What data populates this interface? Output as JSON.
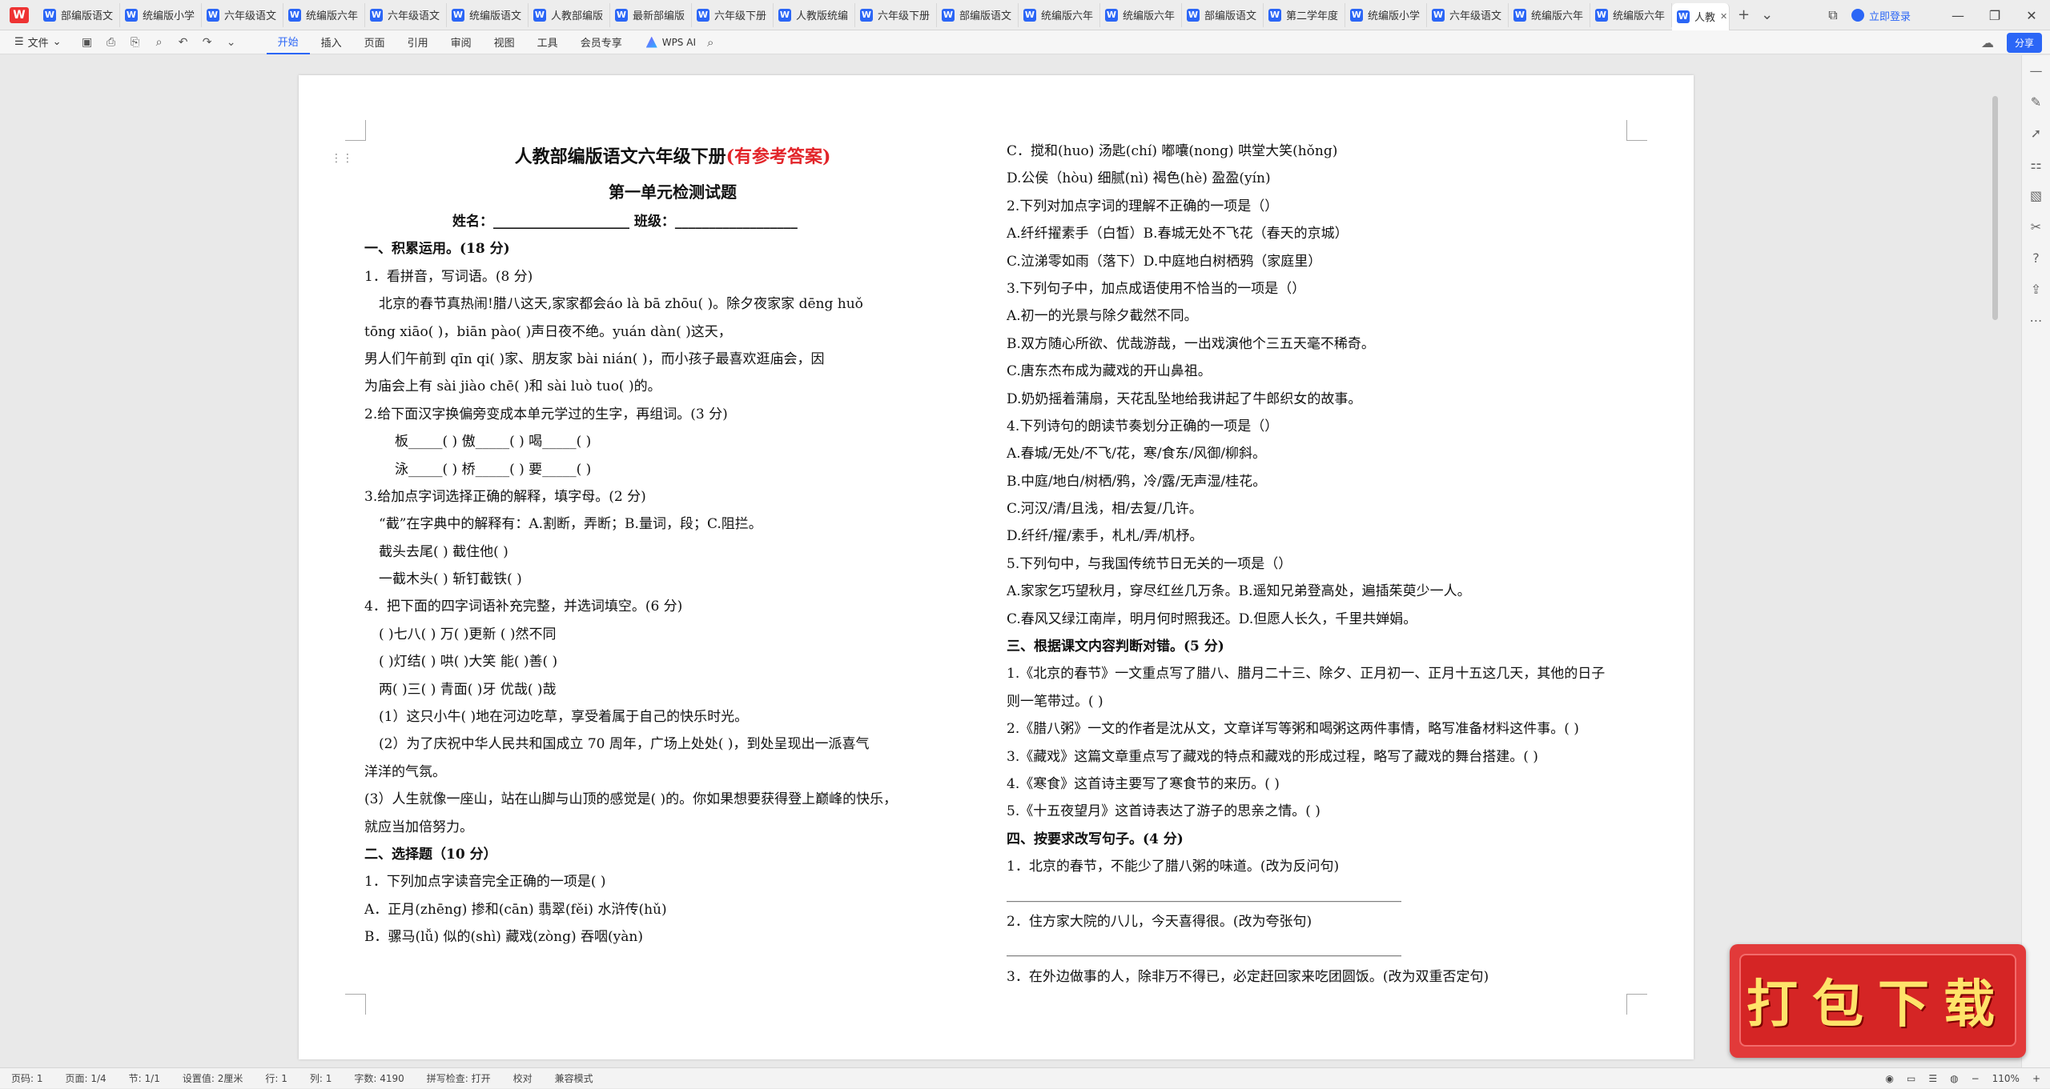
{
  "app": {
    "logo": "W"
  },
  "tabs": [
    {
      "label": "部编版语文"
    },
    {
      "label": "统编版小学"
    },
    {
      "label": "六年级语文"
    },
    {
      "label": "统编版六年"
    },
    {
      "label": "六年级语文"
    },
    {
      "label": "统编版语文"
    },
    {
      "label": "人教部编版"
    },
    {
      "label": "最新部编版"
    },
    {
      "label": "六年级下册"
    },
    {
      "label": "人教版统编"
    },
    {
      "label": "六年级下册"
    },
    {
      "label": "部编版语文"
    },
    {
      "label": "统编版六年"
    },
    {
      "label": "统编版六年"
    },
    {
      "label": "部编版语文"
    },
    {
      "label": "第二学年度"
    },
    {
      "label": "统编版小学"
    },
    {
      "label": "六年级语文"
    },
    {
      "label": "统编版六年"
    },
    {
      "label": "统编版六年"
    }
  ],
  "active_tab": {
    "label": "人教"
  },
  "tab_controls": {
    "add": "+",
    "dropdown": "⌄"
  },
  "window": {
    "login": "立即登录",
    "minimize": "—",
    "restore": "❐",
    "close": "✕",
    "tile": "⧉"
  },
  "toolbar": {
    "file": "文件",
    "menus": [
      "开始",
      "插入",
      "页面",
      "引用",
      "审阅",
      "视图",
      "工具",
      "会员专享"
    ],
    "active_menu": "开始",
    "ai": "WPS AI",
    "share": "分享"
  },
  "document": {
    "title_main": "人教部编版语文六年级下册",
    "title_red": "(有参考答案)",
    "subtitle": "第一单元检测试题",
    "name_line": "姓名：____________________  班级：__________________",
    "left_lines": [
      {
        "t": "一、积累运用。(18 分)",
        "s": "sec"
      },
      {
        "t": "1．看拼音，写词语。(8 分)",
        "s": ""
      },
      {
        "t": "北京的春节真热闹!腊八这天,家家都会áo  là  bā  zhōu(          )。除夕夜家家 dēng  huǒ",
        "s": "in1"
      },
      {
        "t": "tōng  xiāo(          )，biān  pào(          )声日夜不绝。yuán  dàn(          )这天，",
        "s": ""
      },
      {
        "t": "男人们午前到 qīn  qi(          )家、朋友家 bài  nián(          )，而小孩子最喜欢逛庙会，因",
        "s": ""
      },
      {
        "t": "为庙会上有 sài  jiào  chē(          )和 sài  luò  tuo(          )的。",
        "s": ""
      },
      {
        "t": "2.给下面汉字换偏旁变成本单元学过的生字，再组词。(3 分)",
        "s": ""
      },
      {
        "t": "板_____(        )      傲_____(        )      喝_____(        )",
        "s": "in2"
      },
      {
        "t": "泳_____(        )      桥_____(        )      要_____(        )",
        "s": "in2"
      },
      {
        "t": "3.给加点字词选择正确的解释，填字母。(2 分)",
        "s": ""
      },
      {
        "t": "“截”在字典中的解释有：A.割断，弄断；B.量词，段；C.阻拦。",
        "s": "in1"
      },
      {
        "t": "截头去尾(      )        截住他(      )",
        "s": "in1"
      },
      {
        "t": "一截木头(      )        斩钉截铁(      )",
        "s": "in1"
      },
      {
        "t": "4．把下面的四字词语补充完整，并选词填空。(6 分)",
        "s": ""
      },
      {
        "t": "(      )七八(      )     万(      )更新         (      )然不同",
        "s": "in1"
      },
      {
        "t": "(      )灯结(      )     哄(      )大笑         能(      )善(      )",
        "s": "in1"
      },
      {
        "t": "两(      )三(      )     青面(      )牙         优哉(      )哉",
        "s": "in1"
      },
      {
        "t": "(1）这只小牛(          )地在河边吃草，享受着属于自己的快乐时光。",
        "s": "in1"
      },
      {
        "t": "(2）为了庆祝中华人民共和国成立 70 周年，广场上处处(                )，到处呈现出一派喜气",
        "s": "in1"
      },
      {
        "t": "洋洋的气氛。",
        "s": ""
      },
      {
        "t": "(3）人生就像一座山，站在山脚与山顶的感觉是(          )的。你如果想要获得登上巅峰的快乐，",
        "s": ""
      },
      {
        "t": "就应当加倍努力。",
        "s": ""
      },
      {
        "t": "二、选择题（10 分）",
        "s": "sec"
      },
      {
        "t": "1．下列加点字读音完全正确的一项是(      )",
        "s": ""
      },
      {
        "t": "A．正月(zhēng)        掺和(cān)        翡翠(fěi)        水浒传(hǔ)",
        "s": ""
      },
      {
        "t": "B．骡马(lǚ)           似的(shì)         藏戏(zòng)       吞咽(yàn)",
        "s": ""
      }
    ],
    "right_lines": [
      {
        "t": "C．搅和(huo)          汤匙(chí)         嘟囔(nong)       哄堂大笑(hǒng)",
        "s": ""
      },
      {
        "t": "D.公侯（hòu)          细腻(nì)  褐色(hè)       盈盈(yín)",
        "s": ""
      },
      {
        "t": "2.下列对加点字词的理解不正确的一项是（）",
        "s": ""
      },
      {
        "t": "A.纤纤擢素手（白皙）B.春城无处不飞花（春天的京城）",
        "s": ""
      },
      {
        "t": "C.泣涕零如雨（落下）D.中庭地白树栖鸦（家庭里）",
        "s": ""
      },
      {
        "t": "3.下列句子中，加点成语使用不恰当的一项是（）",
        "s": ""
      },
      {
        "t": "A.初一的光景与除夕截然不同。",
        "s": ""
      },
      {
        "t": "B.双方随心所欲、优哉游哉，一出戏演他个三五天毫不稀奇。",
        "s": ""
      },
      {
        "t": "C.唐东杰布成为藏戏的开山鼻祖。",
        "s": ""
      },
      {
        "t": "D.奶奶摇着蒲扇，天花乱坠地给我讲起了牛郎织女的故事。",
        "s": ""
      },
      {
        "t": "4.下列诗句的朗读节奏划分正确的一项是（）",
        "s": ""
      },
      {
        "t": "A.春城/无处/不飞/花，寒/食东/风御/柳斜。",
        "s": ""
      },
      {
        "t": "B.中庭/地白/树栖/鸦，冷/露/无声湿/桂花。",
        "s": ""
      },
      {
        "t": "C.河汉/清/且浅，相/去复/几许。",
        "s": ""
      },
      {
        "t": "D.纤纤/擢/素手，札札/弄/机杼。",
        "s": ""
      },
      {
        "t": "5.下列句中，与我国传统节日无关的一项是（）",
        "s": ""
      },
      {
        "t": "A.家家乞巧望秋月，穿尽红丝几万条。B.遥知兄弟登高处，遍插茱萸少一人。",
        "s": ""
      },
      {
        "t": "C.春风又绿江南岸，明月何时照我还。D.但愿人长久，千里共婵娟。",
        "s": ""
      },
      {
        "t": "三、根据课文内容判断对错。(5 分)",
        "s": "sec"
      },
      {
        "t": "1.《北京的春节》一文重点写了腊八、腊月二十三、除夕、正月初一、正月十五这几天，其他的日子",
        "s": ""
      },
      {
        "t": "则一笔带过。(      )",
        "s": ""
      },
      {
        "t": "2.《腊八粥》一文的作者是沈从文，文章详写等粥和喝粥这两件事情，略写准备材料这件事。(      )",
        "s": ""
      },
      {
        "t": "3.《藏戏》这篇文章重点写了藏戏的特点和藏戏的形成过程，略写了藏戏的舞台搭建。(      )",
        "s": ""
      },
      {
        "t": "4.《寒食》这首诗主要写了寒食节的来历。(      )",
        "s": ""
      },
      {
        "t": "5.《十五夜望月》这首诗表达了游子的思亲之情。(      )",
        "s": ""
      },
      {
        "t": "四、按要求改写句子。(4 分)",
        "s": "sec"
      },
      {
        "t": "1．北京的春节，不能少了腊八粥的味道。(改为反问句)",
        "s": ""
      },
      {
        "t": "__________________________________________________________",
        "s": ""
      },
      {
        "t": "2．住方家大院的八儿，今天喜得很。(改为夸张句)",
        "s": ""
      },
      {
        "t": "__________________________________________________________",
        "s": ""
      },
      {
        "t": "3．在外边做事的人，除非万不得已，必定赶回家来吃团圆饭。(改为双重否定句)",
        "s": ""
      }
    ]
  },
  "download_button": {
    "label": "打包下载"
  },
  "status": {
    "page_code": "页码: 1",
    "pages": "页面: 1/4",
    "section": "节: 1/1",
    "setting": "设置值: 2厘米",
    "row": "行: 1",
    "column": "列: 1",
    "words": "字数: 4190",
    "spellcheck": "拼写检查: 打开",
    "proof": "校对",
    "compat": "兼容模式",
    "zoom": "110%"
  }
}
